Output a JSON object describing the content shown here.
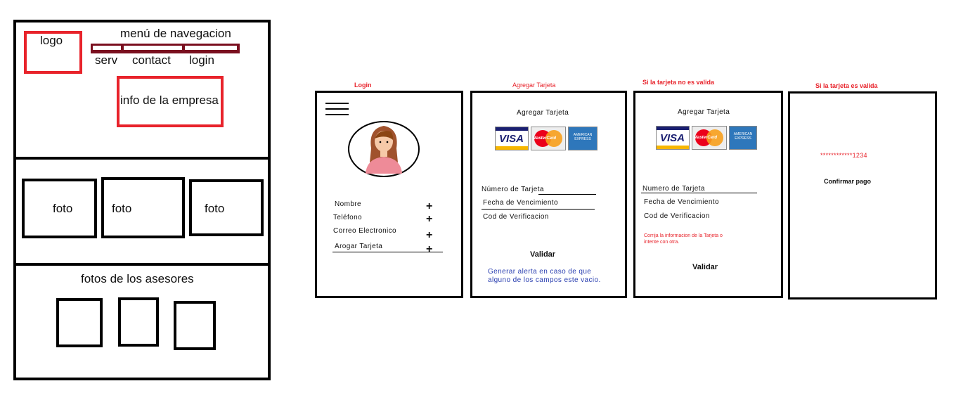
{
  "wireframe": {
    "logo": "logo",
    "nav_title": "menú de navegacion",
    "nav_items": [
      "serv",
      "contact",
      "login"
    ],
    "company_info": "info de la empresa",
    "photos": [
      "foto",
      "foto",
      "foto"
    ],
    "advisors_title": "fotos de los asesores"
  },
  "screens": {
    "login": {
      "caption": "Login",
      "fields": [
        "Nombre",
        "Teléfono",
        "Correo Electronico",
        "Arogar Tarjeta"
      ],
      "plus_symbol": "+"
    },
    "add_card": {
      "caption": "Agregar Tarjeta",
      "heading": "Agregar Tarjeta",
      "card_brands": [
        "VISA",
        "MasterCard",
        "AMERICAN EXPRESS"
      ],
      "fields": [
        "Número de Tarjeta",
        "Fecha de Vencimiento",
        "Cod de Verificacion"
      ],
      "button": "Validar",
      "note_line1": "Generar alerta en caso de que",
      "note_line2": "alguno de los campos este vacio."
    },
    "invalid_card": {
      "caption": "Si la tarjeta no es valida",
      "heading": "Agregar Tarjeta",
      "card_brands": [
        "VISA",
        "MasterCard",
        "AMERICAN EXPRESS"
      ],
      "fields": [
        "Numero de Tarjeta",
        "Fecha de Vencimiento",
        "Cod de Verificacion"
      ],
      "error_line1": "Corrija la informacion de la Tarjeta o",
      "error_line2": "intente con otra.",
      "button": "Validar"
    },
    "valid_card": {
      "caption": "Si la tarjeta es valida",
      "masked_number": "************1234",
      "button": "Confirmar pago"
    }
  },
  "colors": {
    "wireframe_red": "#e8232b",
    "nav_bar": "#7a0f1f",
    "caption_red": "#e8232b",
    "note_blue": "#2a3fb0"
  }
}
